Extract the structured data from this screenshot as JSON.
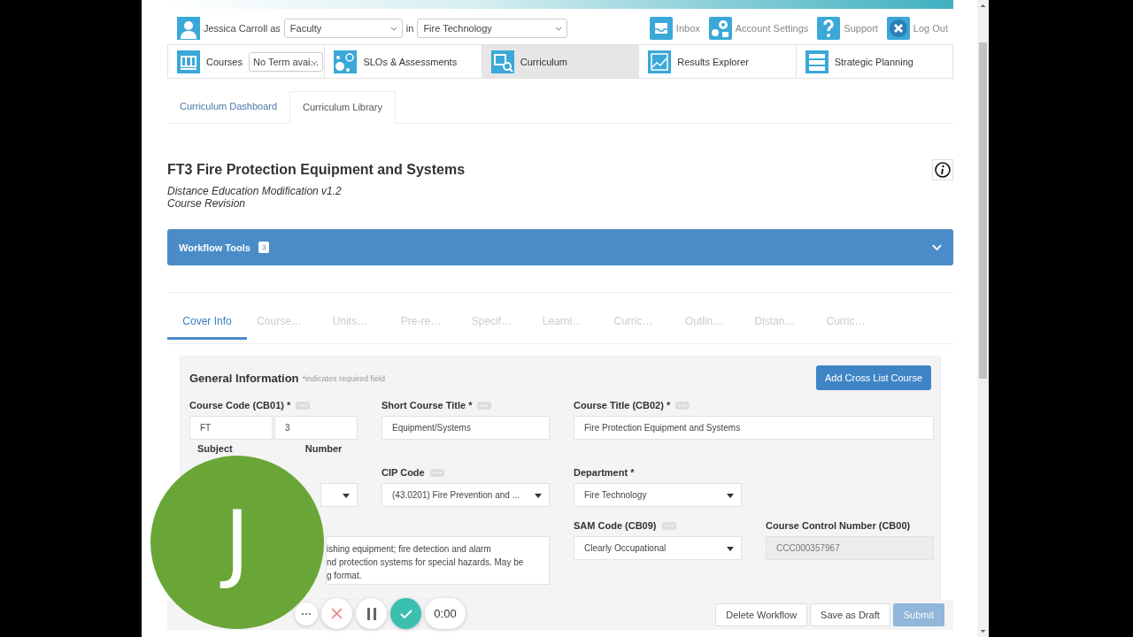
{
  "header": {
    "user": "Jessica Carroll as",
    "role": "Faculty",
    "in_label": "in",
    "unit": "Fire Technology",
    "links": [
      {
        "label": "Inbox"
      },
      {
        "label": "Account Settings"
      },
      {
        "label": "Support"
      },
      {
        "label": "Log Out"
      }
    ]
  },
  "nav": [
    {
      "label": "Courses",
      "select": "No Term avai...",
      "selected": false
    },
    {
      "label": "SLOs & Assessments",
      "selected": false
    },
    {
      "label": "Curriculum",
      "selected": true
    },
    {
      "label": "Results Explorer",
      "selected": false
    },
    {
      "label": "Strategic Planning",
      "selected": false
    }
  ],
  "subtabs": [
    {
      "label": "Curriculum Dashboard",
      "selected": false
    },
    {
      "label": "Curriculum Library",
      "selected": true
    }
  ],
  "course": {
    "title": "FT3 Fire Protection Equipment and Systems",
    "subtitle": "Distance Education Modification v1.2",
    "type": "Course Revision"
  },
  "workflow": {
    "label": "Workflow Tools",
    "count": "3",
    "expanded": false
  },
  "tabs": [
    {
      "label": "Cover Info",
      "selected": true
    },
    {
      "label": "Course…",
      "selected": false
    },
    {
      "label": "Units…",
      "selected": false
    },
    {
      "label": "Pre-re…",
      "selected": false
    },
    {
      "label": "Specif…",
      "selected": false
    },
    {
      "label": "Learni…",
      "selected": false
    },
    {
      "label": "Curric…",
      "selected": false
    },
    {
      "label": "Outlin…",
      "selected": false
    },
    {
      "label": "Distan…",
      "selected": false
    },
    {
      "label": "Curric…",
      "selected": false
    }
  ],
  "form": {
    "title": "General Information",
    "note": "*indicates required field",
    "add_button": "Add Cross List Course",
    "fields": [
      {
        "kind": "code",
        "label": "Course Code (CB01) *",
        "info": true,
        "subject": "FT",
        "number": "3",
        "subject_label": "Subject",
        "number_label": "Number"
      },
      {
        "kind": "text",
        "label": "Short Course Title *",
        "info": true,
        "value": "Equipment/Systems"
      },
      {
        "kind": "wide",
        "label": "Course Title (CB02) *",
        "info": true,
        "value": "Fire Protection Equipment and Systems"
      },
      {
        "kind": "select"
      },
      {
        "kind": "select",
        "label": "CIP Code",
        "info": true,
        "value": "(43.0201) Fire Prevention and ..."
      },
      {
        "kind": "select",
        "label": "Department *",
        "info": false,
        "value": "Fire Technology"
      },
      {
        "kind": "textarea",
        "lines": [
          "ishing equipment; fire detection and alarm",
          "nd protection systems for special hazards. May be",
          "g format."
        ]
      },
      {
        "kind": "select",
        "label": "SAM Code (CB09)",
        "info": true,
        "value": "Clearly Occupational"
      },
      {
        "kind": "readonly",
        "label": "Course Control Number (CB00)",
        "info": false,
        "value": "CCC000357967"
      }
    ]
  },
  "actions": [
    {
      "label": "Delete Workflow",
      "disabled": false
    },
    {
      "label": "Save as Draft",
      "disabled": false
    },
    {
      "label": "Submit",
      "disabled": true,
      "primary": true
    }
  ],
  "recorder": {
    "initial": "J",
    "time": "0:00"
  }
}
